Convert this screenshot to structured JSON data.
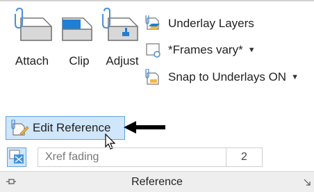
{
  "ribbon_panel": {
    "title": "Reference",
    "large_buttons": [
      {
        "label": "Attach",
        "icon": "attach-file-icon"
      },
      {
        "label": "Clip",
        "icon": "clip-icon"
      },
      {
        "label": "Adjust",
        "icon": "adjust-icon"
      }
    ],
    "underlay_layers_label": "Underlay Layers",
    "frames_label": "*Frames vary*",
    "snap_label": "Snap to Underlays ON",
    "edit_reference_label": "Edit Reference",
    "xref_fading_label": "Xref fading",
    "xref_fading_value": "2"
  },
  "colors": {
    "highlight_fill": "#cfe6fb",
    "highlight_border": "#5ea2e3",
    "icon_blue": "#1e7fd4"
  }
}
